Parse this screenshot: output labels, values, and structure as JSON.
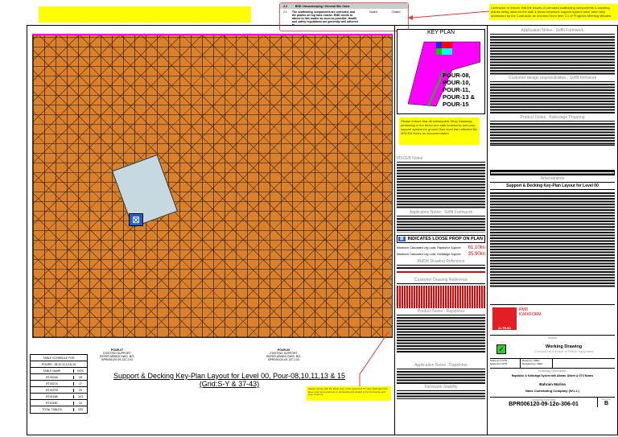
{
  "top_table": {
    "section_no": "2.0",
    "section_title": "BSE / Housekeeping / General Site Order",
    "row_no": "2.1",
    "row_text": "The scaffolding components are corroded, and the planks on top have cracks. RMD needs to attend to this matter as soon as possible. Health and safety regulations are generally well adhered to.",
    "col_a": "Noted",
    "col_b": "Closed"
  },
  "top_right_note": "Contractor to ensure that the issues of corroded scaffolding components & cracking planks being used for the slab & beam formwork support system have been fully addressed by the Contractor as recorded from item 2.1 of Progress Meeting Minutes",
  "key_plan": {
    "title": "KEY PLAN",
    "pours": [
      "POUR-08,",
      "POUR-10,",
      "POUR-11,",
      "POUR-13 &",
      "POUR-15"
    ]
  },
  "mid_note": "Please ensure that all subsequent Shop Drawings pertaining to the beam and slab formworks and prop support system for ground floor level has reflected the MSCEB Notes as accommodated.",
  "mid_sections": {
    "msceb": "MSCEB Notes",
    "app_notes": "Application Notes : Soffit Formwork",
    "loose_prop": "INDICATES LOOSE PROP ON PLAN",
    "load1_label": "Maximum Calculated Leg Load: Rapidshor Support:",
    "load1_value": "61.10kn",
    "load2_label": "Maximum Calculated Leg Load: Kwikstage Support:",
    "load2_value": "35.90kn",
    "rmdk_ref": "RMDK Drawing Reference",
    "cust_ref": "Customer Drawing Reference",
    "prod_rapid": "Product Notes : Rapidshor",
    "prod_rapid2": "Application Notes : Rapidshor",
    "formwork": "Formwork Stability"
  },
  "right_sections": {
    "app_soffit": "Application Notes : Soffit Formwork",
    "cust_design": "Customer design responsibilities : Soffit formwork",
    "prod_kwik": "Product Notes : Kwikstage Propping",
    "amendments": "Amendments",
    "drawing_title": "Support & Decking Key-Plan Layout for Level 00"
  },
  "title_block": {
    "company": "RMD KWIKFORM",
    "brand": "ALTRAD",
    "status_label": "Status",
    "status": "Working Drawing",
    "status_sub": "Checked for erection of RMDK equipment",
    "scale_a1": "Scale A1 1:NTS",
    "scale_a3": "Scale A3 1:NTS",
    "drawn_by": "Drawn by: MMC",
    "designed_by": "Designed by: MMC",
    "desc_label": "Drawing Description",
    "desc": "Rapidshor & Kwikstage System with Albeam, Alform & GTX Beams",
    "project": "Bahrain Marina",
    "client": "Nass Contracting Company (W.L.L)",
    "num_label": "Drawing Number",
    "number": "BPR006120-09-12o-306-01",
    "rev_label": "Revision",
    "revision": "B"
  },
  "schedule": {
    "title": "TABLE SCHEDULE FOR",
    "subtitle": "POURS - 08,10,11,13 & 15",
    "headers": [
      "TABLE NAME",
      "NOS"
    ],
    "rows": [
      [
        "RT4024A",
        "28"
      ],
      [
        "RT4027A",
        "27"
      ],
      [
        "RT4027B",
        "25"
      ],
      [
        "RT4018A",
        "143"
      ],
      [
        "RT4018C",
        "10"
      ]
    ],
    "total": [
      "TOTAL TABLES",
      "233"
    ]
  },
  "pour_labels": [
    {
      "title": "POUR-07",
      "lines": [
        "EXISTING SUPPORT",
        "REFER ARMDK DWG. NO.",
        "BPR006120-09-12C-103"
      ]
    },
    {
      "title": "POUR-09",
      "lines": [
        "EXISTING SUPPORT",
        "REFER ARMDK DWG. NO.",
        "BPR006120-09-12C-103"
      ]
    }
  ],
  "main_title": "Support & Decking Key-Plan Layout for Level 00, Pour-08,10,11,13 & 15",
  "main_subtitle": "(Grid:S-Y & 37-43)",
  "bottom_note": "Please ensure that the latest copy of the approved PT shop drawings have been used as a reference in developing the details of the formworks and prop supports."
}
